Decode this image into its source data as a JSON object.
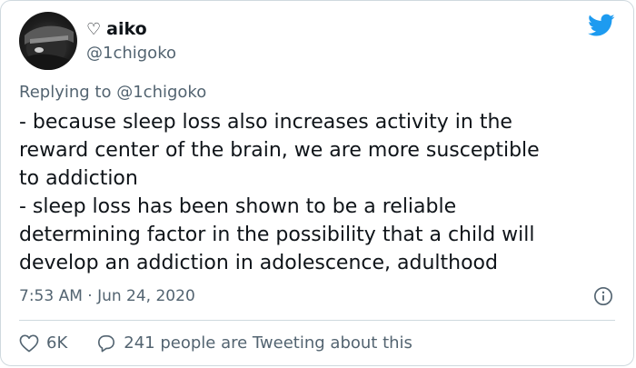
{
  "author": {
    "heart_glyph": "♡",
    "display_name": "aiko",
    "handle": "@1chigoko"
  },
  "reply_context": {
    "prefix": "Replying to",
    "mention": "@1chigoko"
  },
  "tweet": {
    "lines": [
      "- because sleep loss also increases activity in the",
      "reward center of the brain, we are more susceptible",
      "to addiction",
      "- sleep loss has been shown to be a reliable",
      "determining factor in the possibility that a child will",
      "develop an addiction in adolescence, adulthood"
    ],
    "timestamp": "7:53 AM · Jun 24, 2020"
  },
  "actions": {
    "like_count": "6K",
    "conversation_label": "241 people are Tweeting about this"
  },
  "colors": {
    "brand": "#1d9bf0",
    "secondary_text": "#536471",
    "border": "#cfd9de"
  },
  "icons": {
    "logo": "twitter-bird-icon",
    "info": "info-icon",
    "like": "heart-icon",
    "reply": "speech-bubble-icon"
  }
}
